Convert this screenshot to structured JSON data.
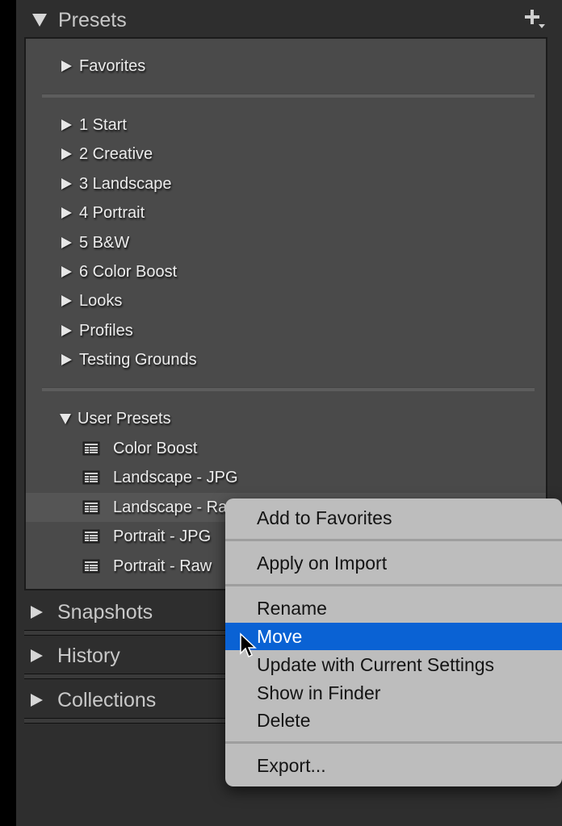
{
  "panel": {
    "title": "Presets",
    "add_button_icon": "plus-dropdown-icon",
    "groups": [
      {
        "items": [
          {
            "label": "Favorites",
            "type": "folder",
            "expanded": false
          }
        ]
      },
      {
        "items": [
          {
            "label": "1 Start",
            "type": "folder",
            "expanded": false
          },
          {
            "label": "2 Creative",
            "type": "folder",
            "expanded": false
          },
          {
            "label": "3 Landscape",
            "type": "folder",
            "expanded": false
          },
          {
            "label": "4 Portrait",
            "type": "folder",
            "expanded": false
          },
          {
            "label": "5 B&W",
            "type": "folder",
            "expanded": false
          },
          {
            "label": "6 Color Boost",
            "type": "folder",
            "expanded": false
          },
          {
            "label": "Looks",
            "type": "folder",
            "expanded": false
          },
          {
            "label": "Profiles",
            "type": "folder",
            "expanded": false
          },
          {
            "label": "Testing Grounds",
            "type": "folder",
            "expanded": false
          }
        ]
      },
      {
        "items": [
          {
            "label": "User Presets",
            "type": "folder",
            "expanded": true
          },
          {
            "label": "Color Boost",
            "type": "preset"
          },
          {
            "label": "Landscape - JPG",
            "type": "preset"
          },
          {
            "label": "Landscape - Raw",
            "type": "preset",
            "highlighted": true
          },
          {
            "label": "Portrait - JPG",
            "type": "preset"
          },
          {
            "label": "Portrait - Raw",
            "type": "preset"
          }
        ]
      }
    ]
  },
  "sections": [
    {
      "label": "Snapshots",
      "expanded": false
    },
    {
      "label": "History",
      "expanded": false
    },
    {
      "label": "Collections",
      "expanded": false
    }
  ],
  "context_menu": {
    "items": [
      {
        "label": "Add to Favorites"
      },
      {
        "separator": true
      },
      {
        "label": "Apply on Import"
      },
      {
        "separator": true
      },
      {
        "label": "Rename"
      },
      {
        "label": "Move",
        "selected": true
      },
      {
        "label": "Update with Current Settings"
      },
      {
        "label": "Show in Finder"
      },
      {
        "label": "Delete"
      },
      {
        "separator": true
      },
      {
        "label": "Export..."
      }
    ],
    "selected_color": "#0a62d4"
  }
}
